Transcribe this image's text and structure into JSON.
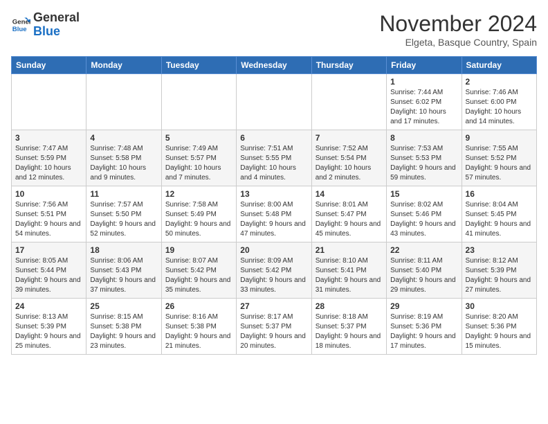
{
  "logo": {
    "general": "General",
    "blue": "Blue"
  },
  "title": "November 2024",
  "subtitle": "Elgeta, Basque Country, Spain",
  "headers": [
    "Sunday",
    "Monday",
    "Tuesday",
    "Wednesday",
    "Thursday",
    "Friday",
    "Saturday"
  ],
  "weeks": [
    [
      {
        "day": "",
        "info": ""
      },
      {
        "day": "",
        "info": ""
      },
      {
        "day": "",
        "info": ""
      },
      {
        "day": "",
        "info": ""
      },
      {
        "day": "",
        "info": ""
      },
      {
        "day": "1",
        "info": "Sunrise: 7:44 AM\nSunset: 6:02 PM\nDaylight: 10 hours and 17 minutes."
      },
      {
        "day": "2",
        "info": "Sunrise: 7:46 AM\nSunset: 6:00 PM\nDaylight: 10 hours and 14 minutes."
      }
    ],
    [
      {
        "day": "3",
        "info": "Sunrise: 7:47 AM\nSunset: 5:59 PM\nDaylight: 10 hours and 12 minutes."
      },
      {
        "day": "4",
        "info": "Sunrise: 7:48 AM\nSunset: 5:58 PM\nDaylight: 10 hours and 9 minutes."
      },
      {
        "day": "5",
        "info": "Sunrise: 7:49 AM\nSunset: 5:57 PM\nDaylight: 10 hours and 7 minutes."
      },
      {
        "day": "6",
        "info": "Sunrise: 7:51 AM\nSunset: 5:55 PM\nDaylight: 10 hours and 4 minutes."
      },
      {
        "day": "7",
        "info": "Sunrise: 7:52 AM\nSunset: 5:54 PM\nDaylight: 10 hours and 2 minutes."
      },
      {
        "day": "8",
        "info": "Sunrise: 7:53 AM\nSunset: 5:53 PM\nDaylight: 9 hours and 59 minutes."
      },
      {
        "day": "9",
        "info": "Sunrise: 7:55 AM\nSunset: 5:52 PM\nDaylight: 9 hours and 57 minutes."
      }
    ],
    [
      {
        "day": "10",
        "info": "Sunrise: 7:56 AM\nSunset: 5:51 PM\nDaylight: 9 hours and 54 minutes."
      },
      {
        "day": "11",
        "info": "Sunrise: 7:57 AM\nSunset: 5:50 PM\nDaylight: 9 hours and 52 minutes."
      },
      {
        "day": "12",
        "info": "Sunrise: 7:58 AM\nSunset: 5:49 PM\nDaylight: 9 hours and 50 minutes."
      },
      {
        "day": "13",
        "info": "Sunrise: 8:00 AM\nSunset: 5:48 PM\nDaylight: 9 hours and 47 minutes."
      },
      {
        "day": "14",
        "info": "Sunrise: 8:01 AM\nSunset: 5:47 PM\nDaylight: 9 hours and 45 minutes."
      },
      {
        "day": "15",
        "info": "Sunrise: 8:02 AM\nSunset: 5:46 PM\nDaylight: 9 hours and 43 minutes."
      },
      {
        "day": "16",
        "info": "Sunrise: 8:04 AM\nSunset: 5:45 PM\nDaylight: 9 hours and 41 minutes."
      }
    ],
    [
      {
        "day": "17",
        "info": "Sunrise: 8:05 AM\nSunset: 5:44 PM\nDaylight: 9 hours and 39 minutes."
      },
      {
        "day": "18",
        "info": "Sunrise: 8:06 AM\nSunset: 5:43 PM\nDaylight: 9 hours and 37 minutes."
      },
      {
        "day": "19",
        "info": "Sunrise: 8:07 AM\nSunset: 5:42 PM\nDaylight: 9 hours and 35 minutes."
      },
      {
        "day": "20",
        "info": "Sunrise: 8:09 AM\nSunset: 5:42 PM\nDaylight: 9 hours and 33 minutes."
      },
      {
        "day": "21",
        "info": "Sunrise: 8:10 AM\nSunset: 5:41 PM\nDaylight: 9 hours and 31 minutes."
      },
      {
        "day": "22",
        "info": "Sunrise: 8:11 AM\nSunset: 5:40 PM\nDaylight: 9 hours and 29 minutes."
      },
      {
        "day": "23",
        "info": "Sunrise: 8:12 AM\nSunset: 5:39 PM\nDaylight: 9 hours and 27 minutes."
      }
    ],
    [
      {
        "day": "24",
        "info": "Sunrise: 8:13 AM\nSunset: 5:39 PM\nDaylight: 9 hours and 25 minutes."
      },
      {
        "day": "25",
        "info": "Sunrise: 8:15 AM\nSunset: 5:38 PM\nDaylight: 9 hours and 23 minutes."
      },
      {
        "day": "26",
        "info": "Sunrise: 8:16 AM\nSunset: 5:38 PM\nDaylight: 9 hours and 21 minutes."
      },
      {
        "day": "27",
        "info": "Sunrise: 8:17 AM\nSunset: 5:37 PM\nDaylight: 9 hours and 20 minutes."
      },
      {
        "day": "28",
        "info": "Sunrise: 8:18 AM\nSunset: 5:37 PM\nDaylight: 9 hours and 18 minutes."
      },
      {
        "day": "29",
        "info": "Sunrise: 8:19 AM\nSunset: 5:36 PM\nDaylight: 9 hours and 17 minutes."
      },
      {
        "day": "30",
        "info": "Sunrise: 8:20 AM\nSunset: 5:36 PM\nDaylight: 9 hours and 15 minutes."
      }
    ]
  ]
}
